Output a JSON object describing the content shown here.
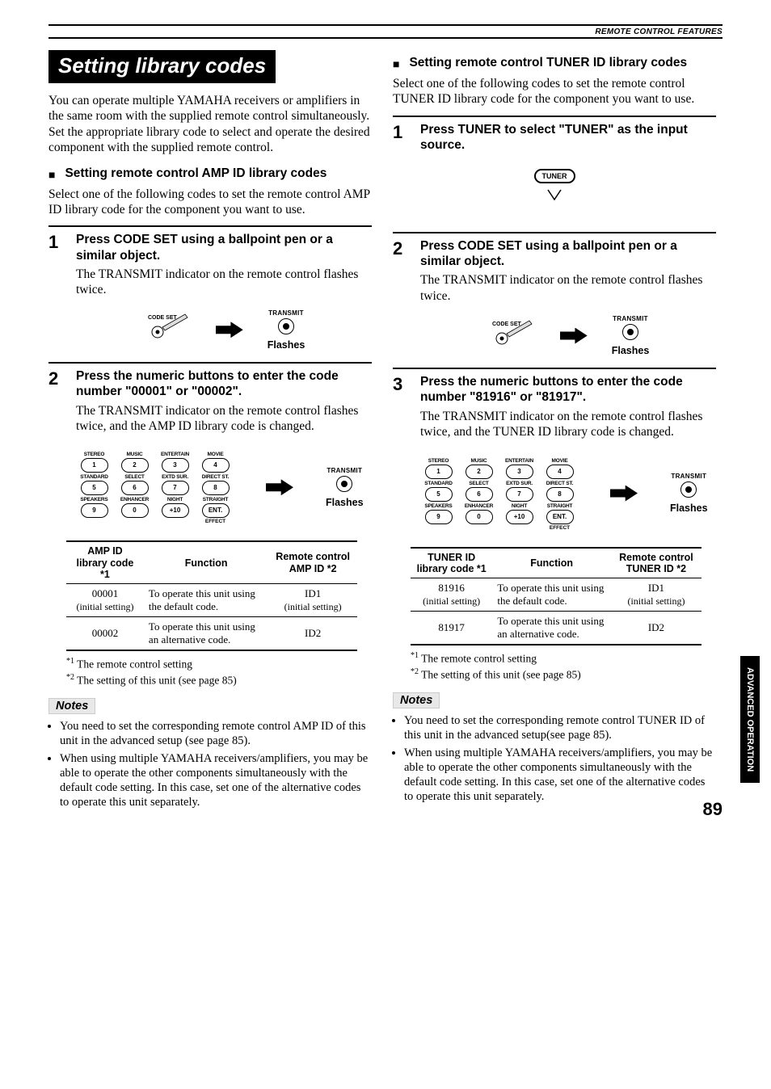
{
  "header": "REMOTE CONTROL FEATURES",
  "title": "Setting library codes",
  "intro": "You can operate multiple YAMAHA receivers or amplifiers in the same room with the supplied remote control simultaneously. Set the appropriate library code to select and operate the desired component with the supplied remote control.",
  "side_tab": "ADVANCED\nOPERATION",
  "page_number": "89",
  "labels": {
    "transmit": "TRANSMIT",
    "flashes": "Flashes",
    "code_set": "CODE SET",
    "tuner": "TUNER",
    "effect": "EFFECT",
    "arrow_icon": "arrow-right"
  },
  "keypad": [
    {
      "top": "STEREO",
      "num": "1",
      "bottom": ""
    },
    {
      "top": "MUSIC",
      "num": "2",
      "bottom": ""
    },
    {
      "top": "ENTERTAIN",
      "num": "3",
      "bottom": ""
    },
    {
      "top": "MOVIE",
      "num": "4",
      "bottom": ""
    },
    {
      "top": "STANDARD",
      "num": "5",
      "bottom": ""
    },
    {
      "top": "SELECT",
      "num": "6",
      "bottom": ""
    },
    {
      "top": "EXTD SUR.",
      "num": "7",
      "bottom": ""
    },
    {
      "top": "DIRECT ST.",
      "num": "8",
      "bottom": ""
    },
    {
      "top": "SPEAKERS",
      "num": "9",
      "bottom": ""
    },
    {
      "top": "ENHANCER",
      "num": "0",
      "bottom": ""
    },
    {
      "top": "NIGHT",
      "num": "+10",
      "bottom": ""
    },
    {
      "top": "STRAIGHT",
      "num": "ENT.",
      "bottom": "EFFECT"
    }
  ],
  "amp": {
    "subhead": "Setting remote control AMP ID library codes",
    "desc": "Select one of the following codes to set the remote control AMP ID library code for the component you want to use.",
    "steps": [
      {
        "num": "1",
        "title": "Press CODE SET using a ballpoint pen or a similar object.",
        "text": "The TRANSMIT indicator on the remote control flashes twice."
      },
      {
        "num": "2",
        "title": "Press the numeric buttons to enter the code number \"00001\" or \"00002\".",
        "text": "The TRANSMIT indicator on the remote control flashes twice, and the AMP ID library code is changed."
      }
    ],
    "table": {
      "headers": [
        "AMP ID library code *1",
        "Function",
        "Remote control AMP ID *2"
      ],
      "rows": [
        {
          "code": "00001",
          "setting": "(initial setting)",
          "fn": "To operate this unit using the default code.",
          "id": "ID1",
          "id_setting": "(initial setting)"
        },
        {
          "code": "00002",
          "setting": "",
          "fn": "To operate this unit using an alternative code.",
          "id": "ID2",
          "id_setting": ""
        }
      ]
    },
    "footnotes": [
      "The remote control setting",
      "The setting of this unit (see page 85)"
    ],
    "notes_label": "Notes",
    "notes": [
      "You need to set the corresponding remote control AMP ID of this unit in the advanced setup (see page 85).",
      "When using multiple YAMAHA receivers/amplifiers, you may be able to operate the other components simultaneously with the default code setting. In this case, set one of the alternative codes to operate this unit separately."
    ]
  },
  "tuner": {
    "subhead": "Setting remote control TUNER ID library codes",
    "desc": "Select one of the following codes to set the remote control TUNER ID library code for the component you want to use.",
    "steps": [
      {
        "num": "1",
        "title": "Press TUNER to select \"TUNER\" as the input source.",
        "text": ""
      },
      {
        "num": "2",
        "title": "Press CODE SET using a ballpoint pen or a similar object.",
        "text": "The TRANSMIT indicator on the remote control flashes twice."
      },
      {
        "num": "3",
        "title": "Press the numeric buttons to enter the code number \"81916\" or \"81917\".",
        "text": "The TRANSMIT indicator on the remote control flashes twice, and the TUNER ID library code is changed."
      }
    ],
    "table": {
      "headers": [
        "TUNER ID library code *1",
        "Function",
        "Remote control TUNER ID *2"
      ],
      "rows": [
        {
          "code": "81916",
          "setting": "(initial setting)",
          "fn": "To operate this unit using the default code.",
          "id": "ID1",
          "id_setting": "(initial setting)"
        },
        {
          "code": "81917",
          "setting": "",
          "fn": "To operate this unit using an alternative code.",
          "id": "ID2",
          "id_setting": ""
        }
      ]
    },
    "footnotes": [
      "The remote control setting",
      "The setting of this unit (see page 85)"
    ],
    "notes_label": "Notes",
    "notes": [
      "You need to set the corresponding remote control TUNER ID of this unit in the advanced setup(see page 85).",
      "When using multiple YAMAHA receivers/amplifiers, you may be able to operate the other components simultaneously with the default code setting. In this case, set one of the alternative codes to operate this unit separately."
    ]
  }
}
